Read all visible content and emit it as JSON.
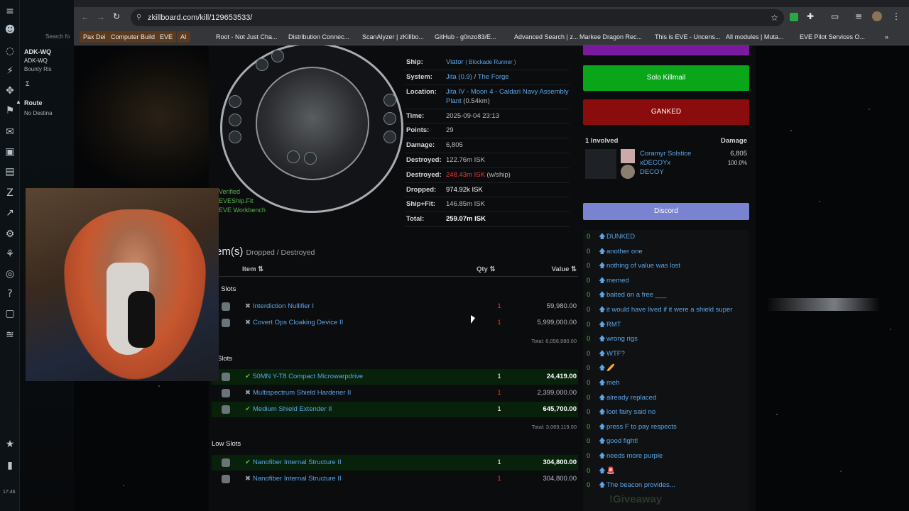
{
  "game": {
    "rail_icons": [
      "menu-icon",
      "avatar-icon",
      "swirl-icon",
      "neocom-icon",
      "compass-icon",
      "inventory-icon",
      "mail-icon",
      "box-icon",
      "book-icon",
      "z-icon",
      "chart-icon",
      "gear-icon",
      "people-icon",
      "agency-icon",
      "help-icon",
      "chat-icon",
      "layers-icon",
      "star-icon",
      "bookmark-icon"
    ],
    "search_placeholder": "Search fo",
    "system_name": "ADK-WQ",
    "system_sub": "ADK-WQ",
    "system_line": "Bounty Ris",
    "route_label": "Route",
    "route_sub": "No Destina",
    "clock": "17:46"
  },
  "browser": {
    "url": "zkillboard.com/kill/129653533/",
    "bookmarks": [
      {
        "label": "Pax Dei",
        "chip": true
      },
      {
        "label": "Computer Build",
        "chip": true
      },
      {
        "label": "EVE",
        "chip": true
      },
      {
        "label": "AI",
        "chip": true
      },
      {
        "label": "Root - Not Just Cha...",
        "chip": false
      },
      {
        "label": "Distribution Connec...",
        "chip": false
      },
      {
        "label": "ScanAlyzer | zKillbo...",
        "chip": false
      },
      {
        "label": "GitHub - g0nzo83/E...",
        "chip": false
      },
      {
        "label": "Advanced Search | z...",
        "chip": false
      },
      {
        "label": "Markee Dragon Rec...",
        "chip": false
      },
      {
        "label": "This is EVE - Uncens...",
        "chip": false
      },
      {
        "label": "All modules | Muta...",
        "chip": false
      },
      {
        "label": "EVE Pilot Services O...",
        "chip": false
      }
    ]
  },
  "fit": {
    "verified_lines": [
      "Verified",
      "EVEShip.Fit",
      "EVE Workbench"
    ]
  },
  "info": {
    "ship_label": "Ship:",
    "ship_name": "Viator",
    "ship_class": "( Blockade Runner )",
    "system_label": "System:",
    "system_name": "Jita (0.9)",
    "system_sep": " / ",
    "region": "The Forge",
    "location_label": "Location:",
    "location_name": "Jita IV - Moon 4 - Caldari Navy Assembly",
    "location_name2": "Plant",
    "location_dist": " (0.54km)",
    "time_label": "Time:",
    "time": "2025-09-04 23:13",
    "points_label": "Points:",
    "points": "29",
    "damage_label": "Damage:",
    "damage": "6,805",
    "destroyed_label": "Destroyed:",
    "destroyed": "122.76m ISK",
    "destroyed2_label": "Destroyed:",
    "destroyed2": "248.43m ISK",
    "destroyed2_suffix": " (w/ship)",
    "dropped_label": "Dropped:",
    "dropped": "974.92k ISK",
    "shipfit_label": "Ship+Fit:",
    "shipfit": "146.85m ISK",
    "total_label": "Total:",
    "total": "259.07m ISK"
  },
  "right": {
    "solo_label": "Solo Killmail",
    "ganked_label": "GANKED",
    "involved_label": "1 Involved",
    "damage_label": "Damage",
    "attacker_name": "Coramyr Solstice",
    "attacker_corp": "xDECOYx",
    "attacker_alliance": "DECOY",
    "attacker_damage": "6,805",
    "attacker_pct": "100.0%",
    "discord_label": "Discord",
    "comments": [
      {
        "count": "0",
        "text": "DUNKED"
      },
      {
        "count": "0",
        "text": "another one"
      },
      {
        "count": "0",
        "text": "nothing of value was lost"
      },
      {
        "count": "0",
        "text": "memed"
      },
      {
        "count": "0",
        "text": "baited on a free ___"
      },
      {
        "count": "0",
        "text": "it would have lived if it were a shield super"
      },
      {
        "count": "0",
        "text": "RMT"
      },
      {
        "count": "0",
        "text": "wrong rigs"
      },
      {
        "count": "0",
        "text": "WTF?"
      },
      {
        "count": "0",
        "text": "🥖"
      },
      {
        "count": "0",
        "text": "meh"
      },
      {
        "count": "0",
        "text": "already replaced"
      },
      {
        "count": "0",
        "text": "loot fairy said no"
      },
      {
        "count": "0",
        "text": "press F to pay respects"
      },
      {
        "count": "0",
        "text": "good fight!"
      },
      {
        "count": "0",
        "text": "needs more purple"
      },
      {
        "count": "0",
        "text": "🚨"
      },
      {
        "count": "0",
        "text": "The beacon provides..."
      }
    ]
  },
  "items": {
    "title": "Items",
    "title_visible": "em(s)",
    "subtitle": "Dropped / Destroyed",
    "col_item": "Item ⇅",
    "col_qty": "Qty ⇅",
    "col_value": "Value ⇅",
    "sections": [
      {
        "label": "gh Slots",
        "rows": [
          {
            "name": "Interdiction Nullifier I",
            "qty": "1",
            "value": "59,980.00",
            "dropped": false
          },
          {
            "name": "Covert Ops Cloaking Device II",
            "qty": "1",
            "value": "5,999,000.00",
            "dropped": false
          }
        ],
        "total": "Total: 6,058,980.00"
      },
      {
        "label": "d Slots",
        "rows": [
          {
            "name": "50MN Y-T8 Compact Microwarpdrive",
            "qty": "1",
            "value": "24,419.00",
            "dropped": true
          },
          {
            "name": "Multispectrum Shield Hardener II",
            "qty": "1",
            "value": "2,399,000.00",
            "dropped": false
          },
          {
            "name": "Medium Shield Extender II",
            "qty": "1",
            "value": "645,700.00",
            "dropped": true
          }
        ],
        "total": "Total: 3,069,119.00"
      },
      {
        "label": "Low Slots",
        "rows": [
          {
            "name": "Nanofiber Internal Structure II",
            "qty": "1",
            "value": "304,800.00",
            "dropped": true
          },
          {
            "name": "Nanofiber Internal Structure II",
            "qty": "1",
            "value": "304,800.00",
            "dropped": false
          }
        ],
        "total": ""
      }
    ]
  },
  "overlay": {
    "giveaway": "!Giveaway"
  },
  "colors": {
    "solo": "#0aa61a",
    "ganked": "#8a0c0c",
    "purple": "#7a1aa0",
    "discord": "#7983cf",
    "link": "#5aa6e8",
    "destroyed": "#e53b2f"
  }
}
